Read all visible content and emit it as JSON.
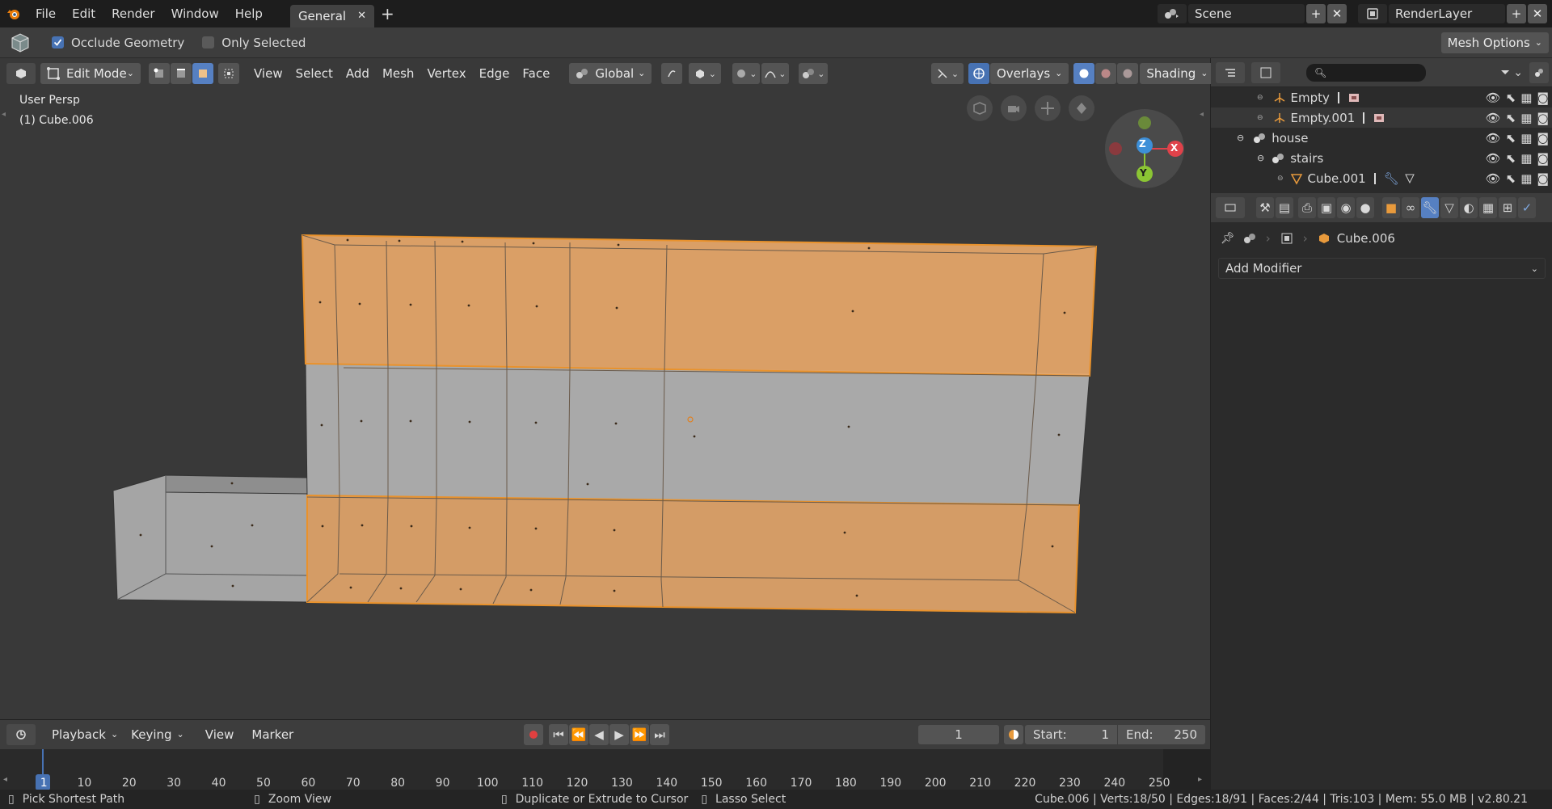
{
  "topbar": {
    "menus": [
      "File",
      "Edit",
      "Render",
      "Window",
      "Help"
    ],
    "workspace_tab": "General",
    "scene_name": "Scene",
    "render_layer": "RenderLayer"
  },
  "tool_header": {
    "occlude_geometry": "Occlude Geometry",
    "only_selected": "Only Selected",
    "mesh_options": "Mesh Options"
  },
  "viewport_header": {
    "mode": "Edit Mode",
    "menus": [
      "View",
      "Select",
      "Add",
      "Mesh",
      "Vertex",
      "Edge",
      "Face"
    ],
    "orientation": "Global",
    "overlays": "Overlays",
    "shading": "Shading"
  },
  "viewport": {
    "view_name": "User Persp",
    "object_info": "(1) Cube.006",
    "gizmo_labels": {
      "z": "Z",
      "x": "X",
      "y": "Y"
    },
    "colors": {
      "selected_face": "#e8a86a",
      "unselected_face": "#a9a9a9",
      "background": "#393939"
    }
  },
  "outliner": {
    "items": [
      {
        "label": "Empty"
      },
      {
        "label": "Empty.001"
      },
      {
        "label": "house"
      },
      {
        "label": "stairs"
      },
      {
        "label": "Cube.001"
      }
    ]
  },
  "properties": {
    "object_name": "Cube.006",
    "add_modifier": "Add Modifier"
  },
  "timeline": {
    "menus": [
      "Playback",
      "Keying",
      "View",
      "Marker"
    ],
    "current_frame": "1",
    "start_label": "Start:",
    "start_value": "1",
    "end_label": "End:",
    "end_value": "250",
    "ticks": [
      "1",
      "10",
      "20",
      "30",
      "40",
      "50",
      "60",
      "70",
      "80",
      "90",
      "100",
      "110",
      "120",
      "130",
      "140",
      "150",
      "160",
      "170",
      "180",
      "190",
      "200",
      "210",
      "220",
      "230",
      "240",
      "250"
    ]
  },
  "statusbar": {
    "hint1": "Pick Shortest Path",
    "hint2": "Zoom View",
    "hint3": "Duplicate or Extrude to Cursor",
    "hint4": "Lasso Select",
    "stats": "Cube.006 | Verts:18/50 | Edges:18/91 | Faces:2/44 | Tris:103 | Mem: 55.0 MB | v2.80.21"
  }
}
